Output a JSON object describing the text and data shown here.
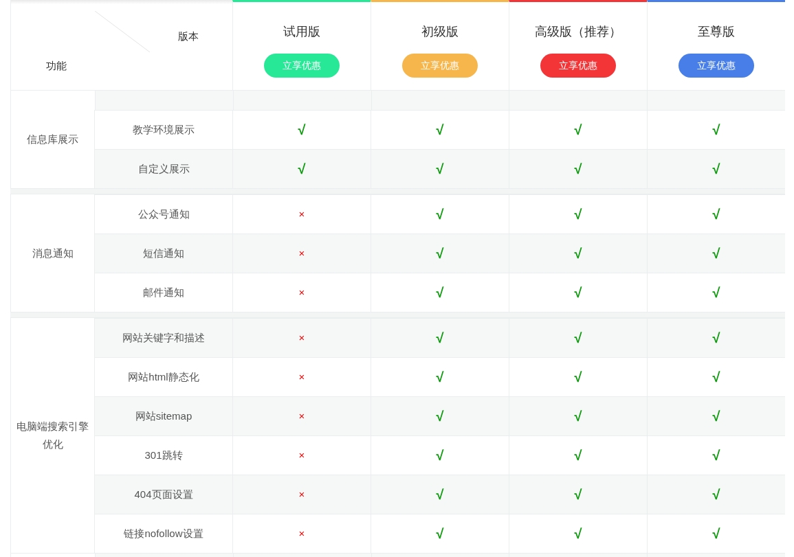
{
  "header": {
    "feature_label": "功能",
    "version_label": "版本",
    "plans": [
      {
        "name": "试用版",
        "button": "立享优惠",
        "color": "#26e896"
      },
      {
        "name": "初级版",
        "button": "立享优惠",
        "color": "#f6b64b"
      },
      {
        "name": "高级版（推荐）",
        "button": "立享优惠",
        "color": "#f43538"
      },
      {
        "name": "至尊版",
        "button": "立享优惠",
        "color": "#477ee8"
      }
    ]
  },
  "groups": [
    {
      "name": "信息库展示",
      "rows": [
        {
          "feature": "教学环境展示",
          "cells": [
            {
              "text": "√",
              "kind": "yes"
            },
            {
              "text": "√",
              "kind": "yes"
            },
            {
              "text": "√",
              "kind": "yes"
            },
            {
              "text": "√",
              "kind": "yes"
            }
          ]
        },
        {
          "feature": "自定义展示",
          "cells": [
            {
              "text": "√",
              "kind": "yes"
            },
            {
              "text": "√",
              "kind": "yes"
            },
            {
              "text": "√",
              "kind": "yes"
            },
            {
              "text": "√",
              "kind": "yes"
            }
          ]
        }
      ]
    },
    {
      "name": "消息通知",
      "rows": [
        {
          "feature": "公众号通知",
          "cells": [
            {
              "text": "×",
              "kind": "no"
            },
            {
              "text": "√",
              "kind": "yes"
            },
            {
              "text": "√",
              "kind": "yes"
            },
            {
              "text": "√",
              "kind": "yes"
            }
          ]
        },
        {
          "feature": "短信通知",
          "cells": [
            {
              "text": "×",
              "kind": "no"
            },
            {
              "text": "√",
              "kind": "yes"
            },
            {
              "text": "√",
              "kind": "yes"
            },
            {
              "text": "√",
              "kind": "yes"
            }
          ]
        },
        {
          "feature": "邮件通知",
          "cells": [
            {
              "text": "×",
              "kind": "no"
            },
            {
              "text": "√",
              "kind": "yes"
            },
            {
              "text": "√",
              "kind": "yes"
            },
            {
              "text": "√",
              "kind": "yes"
            }
          ]
        }
      ]
    },
    {
      "name": "电脑端搜索引擎优化",
      "rows": [
        {
          "feature": "网站关键字和描述",
          "cells": [
            {
              "text": "×",
              "kind": "no"
            },
            {
              "text": "√",
              "kind": "yes"
            },
            {
              "text": "√",
              "kind": "yes"
            },
            {
              "text": "√",
              "kind": "yes"
            }
          ]
        },
        {
          "feature": "网站html静态化",
          "cells": [
            {
              "text": "×",
              "kind": "no"
            },
            {
              "text": "√",
              "kind": "yes"
            },
            {
              "text": "√",
              "kind": "yes"
            },
            {
              "text": "√",
              "kind": "yes"
            }
          ]
        },
        {
          "feature": "网站sitemap",
          "cells": [
            {
              "text": "×",
              "kind": "no"
            },
            {
              "text": "√",
              "kind": "yes"
            },
            {
              "text": "√",
              "kind": "yes"
            },
            {
              "text": "√",
              "kind": "yes"
            }
          ]
        },
        {
          "feature": "301跳转",
          "cells": [
            {
              "text": "×",
              "kind": "no"
            },
            {
              "text": "√",
              "kind": "yes"
            },
            {
              "text": "√",
              "kind": "yes"
            },
            {
              "text": "√",
              "kind": "yes"
            }
          ]
        },
        {
          "feature": "404页面设置",
          "cells": [
            {
              "text": "×",
              "kind": "no"
            },
            {
              "text": "√",
              "kind": "yes"
            },
            {
              "text": "√",
              "kind": "yes"
            },
            {
              "text": "√",
              "kind": "yes"
            }
          ]
        },
        {
          "feature": "链接nofollow设置",
          "cells": [
            {
              "text": "×",
              "kind": "no"
            },
            {
              "text": "√",
              "kind": "yes"
            },
            {
              "text": "√",
              "kind": "yes"
            },
            {
              "text": "√",
              "kind": "yes"
            }
          ]
        }
      ]
    }
  ]
}
